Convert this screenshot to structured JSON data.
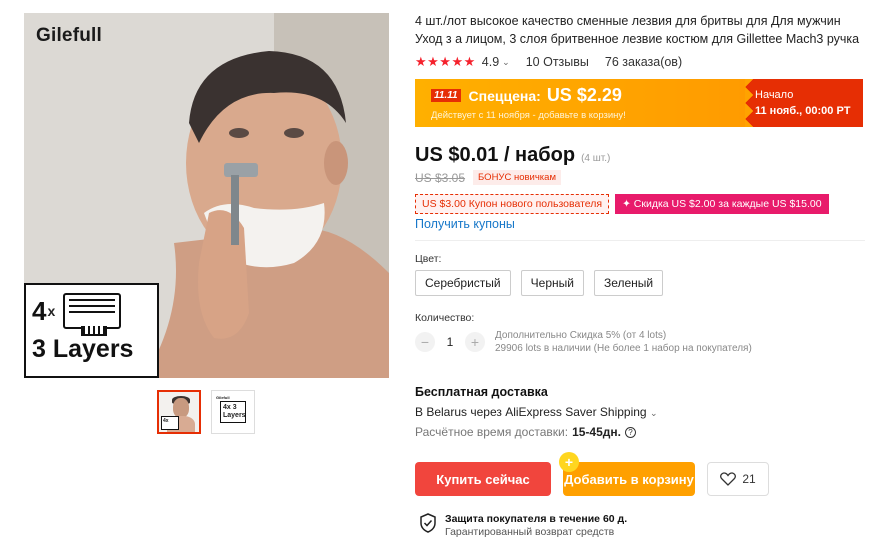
{
  "gallery": {
    "brand": "Gilefull",
    "badge_count": "4",
    "badge_x": "x",
    "badge_layers": "3 Layers",
    "thumb2_brand": "Gilefull",
    "thumb2_text": "4x 3 Layers"
  },
  "product": {
    "title": "4 шт./лот высокое качество сменные лезвия для бритвы для Для мужчин Уход з а лицом, 3 слоя бритвенное лезвие костюм для Gillettee Mach3 ручка",
    "stars": "★★★★★",
    "rating": "4.9",
    "reviews": "10 Отзывы",
    "orders": "76 заказа(ов)"
  },
  "promo": {
    "tag": "11.11",
    "label": "Спеццена:",
    "price": "US $2.29",
    "sub": "Действует с 11 ноября - добавьте в корзину!",
    "start_label": "Начало",
    "start_time": "11 нояб., 00:00 PT"
  },
  "price": {
    "main": "US $0.01 / набор",
    "unit": "(4 шт.)",
    "old": "US $3.05",
    "bonus": "БОНУС новичкам"
  },
  "coupons": [
    "US $3.00 Купон нового пользователя",
    "✦ Скидка US $2.00 за каждые US $15.00"
  ],
  "get_coupons": "Получить купоны",
  "color": {
    "label": "Цвет:",
    "options": [
      "Серебристый",
      "Черный",
      "Зеленый"
    ]
  },
  "quantity": {
    "label": "Количество:",
    "minus": "−",
    "value": "1",
    "plus": "+",
    "info1": "Дополнительно Скидка 5% (от 4 lots)",
    "info2": "29906 lots в наличии (Не более 1 набор на покупателя)"
  },
  "shipping": {
    "title": "Бесплатная доставка",
    "line": "В Belarus через AliExpress Saver Shipping",
    "time_label": "Расчётное время доставки:",
    "time_value": "15-45дн."
  },
  "actions": {
    "buy": "Купить сейчас",
    "cart": "Добавить в корзину",
    "cart_badge": "+",
    "wish_count": "21"
  },
  "protection": {
    "line1": "Защита покупателя в течение 60 д.",
    "line2": "Гарантированный возврат средств"
  },
  "colors": {
    "accent_red": "#e62e04",
    "promo_orange": "#ff9b00",
    "buy_button": "#f1453d",
    "cart_button": "#ffa000",
    "link": "#1677c9",
    "coupon_pink": "#e81b6b"
  }
}
